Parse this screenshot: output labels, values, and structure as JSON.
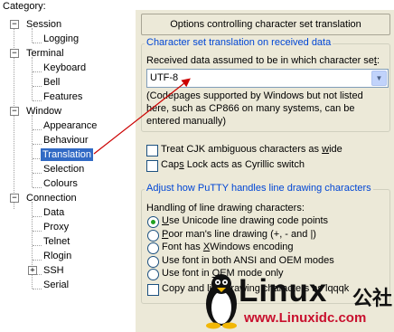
{
  "category_label": "Category:",
  "tree": [
    {
      "label": "Session",
      "expander": "−"
    },
    {
      "label": "Logging"
    },
    {
      "label": "Terminal",
      "expander": "−"
    },
    {
      "label": "Keyboard"
    },
    {
      "label": "Bell"
    },
    {
      "label": "Features"
    },
    {
      "label": "Window",
      "expander": "−"
    },
    {
      "label": "Appearance"
    },
    {
      "label": "Behaviour"
    },
    {
      "label": "Translation",
      "selected": true
    },
    {
      "label": "Selection"
    },
    {
      "label": "Colours"
    },
    {
      "label": "Connection",
      "expander": "−"
    },
    {
      "label": "Data"
    },
    {
      "label": "Proxy"
    },
    {
      "label": "Telnet"
    },
    {
      "label": "Rlogin"
    },
    {
      "label": "SSH",
      "expander": "+"
    },
    {
      "label": "Serial"
    }
  ],
  "panel_title": "Options controlling character set translation",
  "charset_group": {
    "title": "Character set translation on received data",
    "label_prefix": "Received data assumed to be in which character se",
    "label_hotkey": "t",
    "label_suffix": ":",
    "selected_value": "UTF-8",
    "note": "(Codepages supported by Windows but not listed here, such as CP866 on many systems, can be entered manually)"
  },
  "checkboxes": {
    "cjk": {
      "prefix": "Treat CJK ambiguous characters as ",
      "hotkey": "w",
      "suffix": "ide",
      "checked": false
    },
    "caps": {
      "prefix": "Cap",
      "hotkey": "s",
      "suffix": " Lock acts as Cyrillic switch",
      "checked": false
    }
  },
  "linedraw_group": {
    "title": "Adjust how PuTTY handles line drawing characters",
    "subtitle": "Handling of line drawing characters:",
    "options": [
      {
        "hotkey": "U",
        "rest": "se Unicode line drawing code points",
        "pre": "",
        "selected": true
      },
      {
        "hotkey": "P",
        "rest": "oor man's line drawing (+, - and |)",
        "pre": "",
        "selected": false
      },
      {
        "pre": "Font has ",
        "hotkey": "X",
        "rest": "Windows encoding",
        "selected": false
      },
      {
        "pre": "Use font in both ANSI and OEM modes",
        "hotkey": "",
        "rest": "",
        "selected": false
      },
      {
        "pre": "Use font in ",
        "hotkey": "O",
        "rest": "EM mode only",
        "selected": false
      }
    ],
    "copy_checkbox": {
      "prefix": "Copy and ",
      "suffix": " line drawing characters as lqqqk",
      "checked": false
    }
  },
  "watermark": {
    "brand": "Linux",
    "cn": "公社",
    "url": "www.Linuxidc.com"
  },
  "colors": {
    "selection": "#316ac5",
    "group_title": "#0046d5",
    "arrow": "#cc0000",
    "radio_dot": "#21a121",
    "url": "#c8102e"
  }
}
